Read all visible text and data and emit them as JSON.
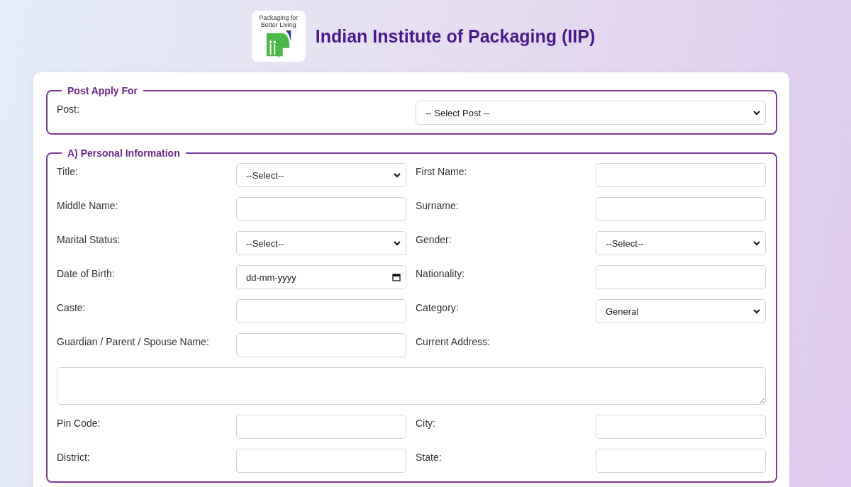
{
  "header": {
    "logo_tagline": "Packaging for Better Living",
    "title": "Indian Institute of Packaging (IIP)"
  },
  "sections": [
    {
      "legend": "Post Apply For",
      "kind": "wide",
      "fields": [
        {
          "label": "Post:",
          "kind": "select",
          "value": "-- Select Post --"
        }
      ]
    },
    {
      "legend": "A) Personal Information",
      "kind": "grid",
      "fields": [
        {
          "label": "Title:",
          "kind": "select",
          "value": "--Select--"
        },
        {
          "label": "First Name:",
          "kind": "text"
        },
        {
          "label": "Middle Name:",
          "kind": "text"
        },
        {
          "label": "Surname:",
          "kind": "text"
        },
        {
          "label": "Marital Status:",
          "kind": "select",
          "value": "--Select--"
        },
        {
          "label": "Gender:",
          "kind": "select",
          "value": "--Select--"
        },
        {
          "label": "Date of Birth:",
          "kind": "date",
          "placeholder": "dd-mm-yyyy"
        },
        {
          "label": "Nationality:",
          "kind": "text"
        },
        {
          "label": "Caste:",
          "kind": "text"
        },
        {
          "label": "Category:",
          "kind": "select",
          "value": "General"
        },
        {
          "label": "Guardian / Parent / Spouse Name:",
          "kind": "text"
        },
        {
          "label": "Current Address:",
          "kind": "textarea"
        },
        {
          "label": "Pin Code:",
          "kind": "text"
        },
        {
          "label": "City:",
          "kind": "text"
        },
        {
          "label": "District:",
          "kind": "text"
        },
        {
          "label": "State:",
          "kind": "text"
        }
      ]
    }
  ]
}
